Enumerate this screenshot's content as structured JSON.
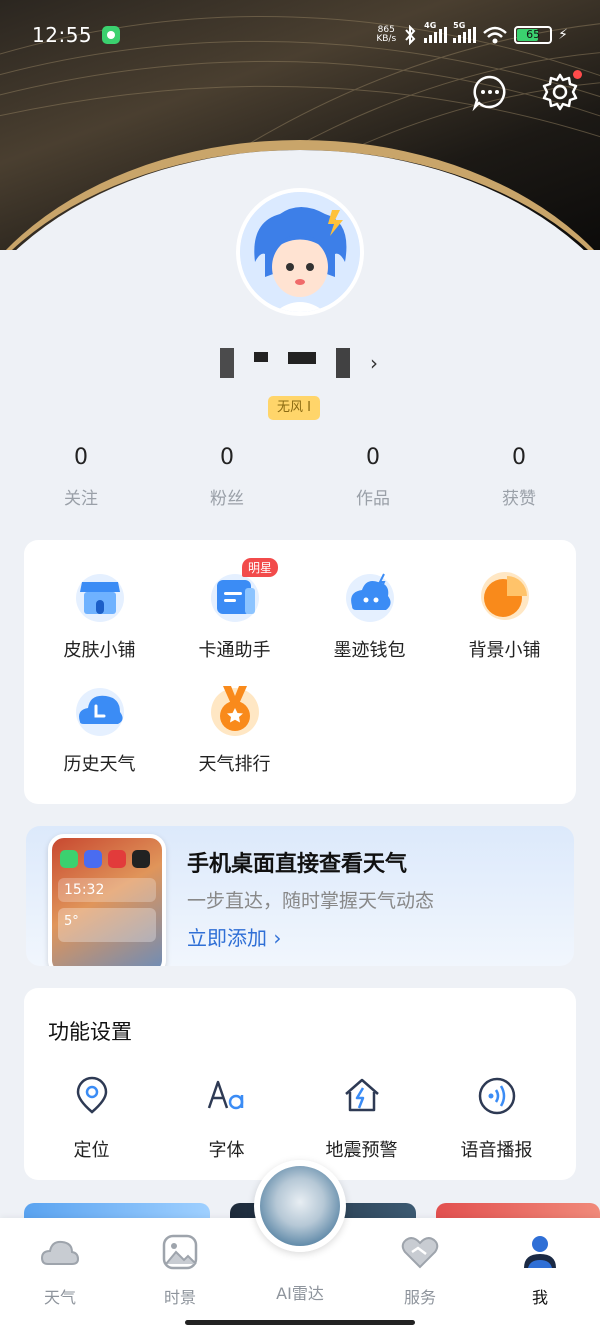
{
  "status_bar": {
    "time": "12:55",
    "net_speed_value": "865",
    "net_speed_unit": "KB/s",
    "signal_1": "4G",
    "signal_2": "5G",
    "wifi_sub": "6",
    "battery": "65"
  },
  "profile": {
    "badge": "无风 I"
  },
  "stats": [
    {
      "value": "0",
      "label": "关注"
    },
    {
      "value": "0",
      "label": "粉丝"
    },
    {
      "value": "0",
      "label": "作品"
    },
    {
      "value": "0",
      "label": "获赞"
    }
  ],
  "tools": {
    "items": [
      {
        "label": "皮肤小铺",
        "icon": "shop-icon"
      },
      {
        "label": "卡通助手",
        "icon": "cartoon-assistant-icon",
        "tag": "明星"
      },
      {
        "label": "墨迹钱包",
        "icon": "wallet-icon"
      },
      {
        "label": "背景小铺",
        "icon": "background-shop-icon"
      },
      {
        "label": "历史天气",
        "icon": "history-weather-icon"
      },
      {
        "label": "天气排行",
        "icon": "ranking-medal-icon"
      }
    ]
  },
  "promo": {
    "title": "手机桌面直接查看天气",
    "subtitle": "一步直达，随时掌握天气动态",
    "link": "立即添加 ›",
    "phone_time": "15:32",
    "phone_temp": "5°"
  },
  "settings": {
    "title": "功能设置",
    "items": [
      {
        "label": "定位",
        "icon": "location-icon"
      },
      {
        "label": "字体",
        "icon": "font-icon"
      },
      {
        "label": "地震预警",
        "icon": "earthquake-alert-icon"
      },
      {
        "label": "语音播报",
        "icon": "voice-broadcast-icon"
      }
    ]
  },
  "bottom_nav": {
    "items": [
      {
        "label": "天气",
        "icon": "cloud-icon"
      },
      {
        "label": "时景",
        "icon": "picture-icon"
      },
      {
        "label": "AI雷达",
        "icon": "ai-radar-icon"
      },
      {
        "label": "服务",
        "icon": "heart-handshake-icon"
      },
      {
        "label": "我",
        "icon": "user-icon",
        "active": true
      }
    ]
  },
  "colors": {
    "accent": "#2f6fd6",
    "badge_bg": "#ffd56a",
    "tag_red": "#f24b4b",
    "battery_green": "#3bd16f"
  }
}
